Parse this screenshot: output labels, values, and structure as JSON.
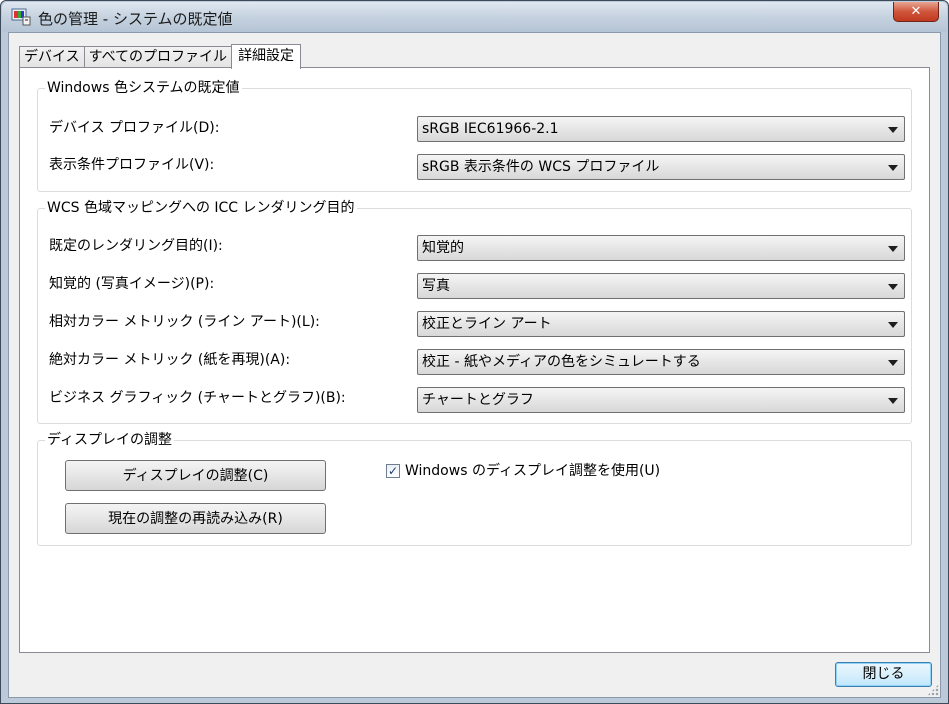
{
  "window": {
    "title": "色の管理 - システムの既定値",
    "close_glyph": "✕"
  },
  "tabs": [
    {
      "label": "デバイス"
    },
    {
      "label": "すべてのプロファイル"
    },
    {
      "label": "詳細設定",
      "active": true
    }
  ],
  "windows_defaults": {
    "legend": "Windows 色システムの既定値",
    "device_profile_label": "デバイス プロファイル(D):",
    "device_profile_value": "sRGB IEC61966-2.1",
    "viewing_profile_label": "表示条件プロファイル(V):",
    "viewing_profile_value": "sRGB 表示条件の WCS プロファイル"
  },
  "icc_mapping": {
    "legend": "WCS 色域マッピングへの ICC レンダリング目的",
    "rows": [
      {
        "label": "既定のレンダリング目的(I):",
        "value": "知覚的"
      },
      {
        "label": "知覚的 (写真イメージ)(P):",
        "value": "写真"
      },
      {
        "label": "相対カラー メトリック (ライン アート)(L):",
        "value": "校正とライン アート"
      },
      {
        "label": "絶対カラー メトリック (紙を再現)(A):",
        "value": "校正 - 紙やメディアの色をシミュレートする"
      },
      {
        "label": "ビジネス グラフィック (チャートとグラフ)(B):",
        "value": "チャートとグラフ"
      }
    ]
  },
  "display_calibration": {
    "legend": "ディスプレイの調整",
    "calibrate_button": "ディスプレイの調整(C)",
    "reload_button": "現在の調整の再読み込み(R)",
    "use_windows_calibration_label": "Windows のディスプレイ調整を使用(U)",
    "use_windows_calibration_checked": true,
    "check_glyph": "✓"
  },
  "footer": {
    "close_button": "閉じる"
  },
  "colors": {
    "accent": "#3c7fb1",
    "title_close": "#c0391f"
  },
  "icons": {
    "app": "color-management-icon",
    "combo": "chevron-down-icon"
  }
}
